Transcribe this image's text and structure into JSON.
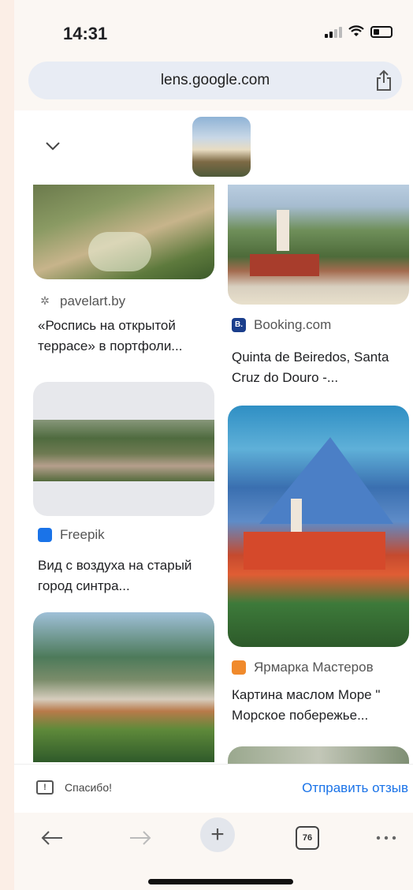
{
  "status": {
    "time": "14:31"
  },
  "browser": {
    "url": "lens.google.com"
  },
  "results": [
    {
      "source": "pavelart.by",
      "title": "«Роспись на открытой террасе» в портфоли...",
      "favicon_color": "#777777"
    },
    {
      "source": "Booking.com",
      "title": "Quinta de Beiredos, Santa Cruz do Douro -...",
      "favicon_color": "#1a3e8c",
      "favicon_letter": "B."
    },
    {
      "source": "Freepik",
      "title": "Вид с воздуха на старый город синтра...",
      "favicon_color": "#1a73e8"
    },
    {
      "source": "Ярмарка Мастеров",
      "title": "Картина маслом Море \" Морское побережье...",
      "favicon_color": "#f08a2c"
    }
  ],
  "feedback": {
    "thanks": "Спасибо!",
    "send": "Отправить отзыв"
  },
  "nav": {
    "tab_count": "76"
  }
}
